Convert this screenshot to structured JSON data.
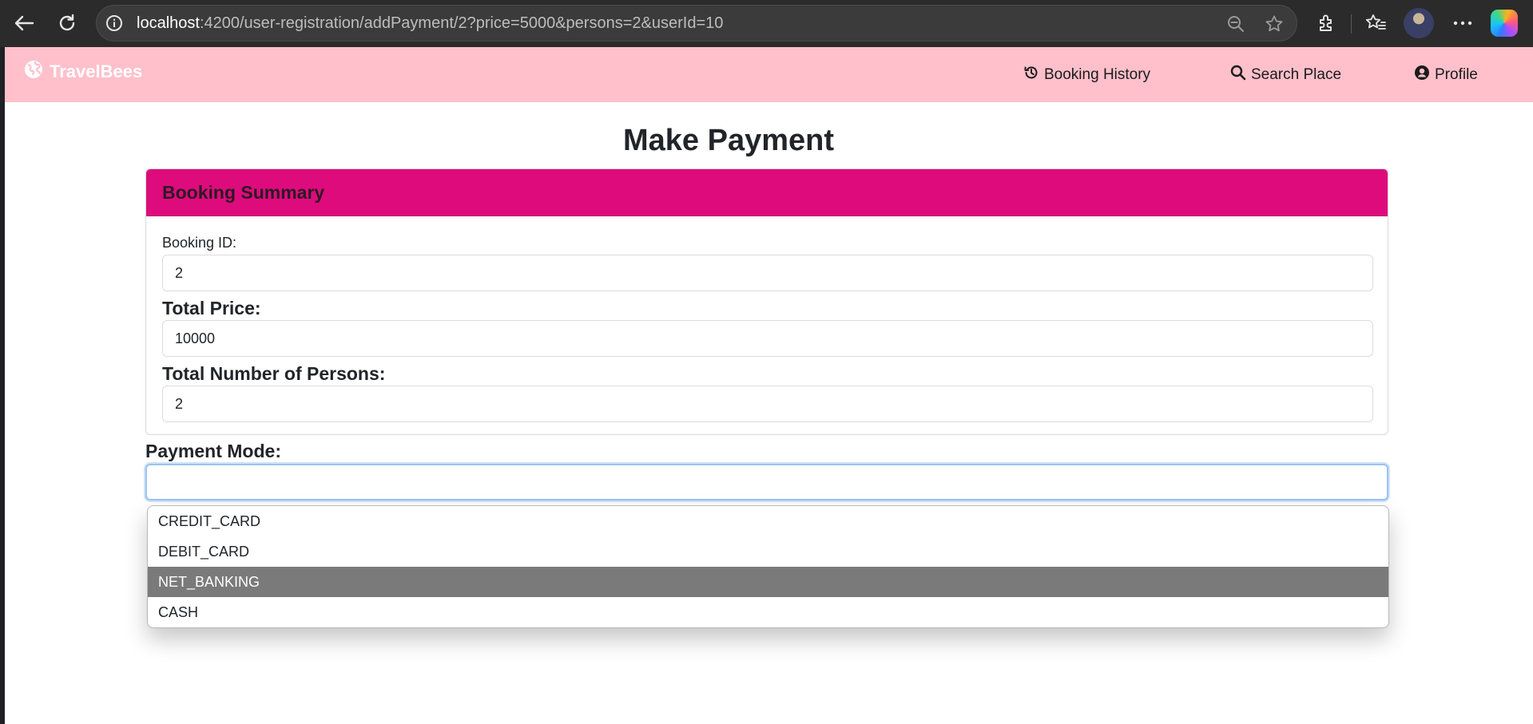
{
  "browser": {
    "url_host": "localhost",
    "url_path": ":4200/user-registration/addPayment/2?price=5000&persons=2&userId=10"
  },
  "navbar": {
    "brand": "TravelBees",
    "links": [
      {
        "label": "Booking History",
        "icon": "history-icon"
      },
      {
        "label": "Search Place",
        "icon": "search-icon"
      },
      {
        "label": "Profile",
        "icon": "user-circle-icon"
      }
    ],
    "background": "#ffc0cb"
  },
  "page": {
    "title": "Make Payment"
  },
  "summary": {
    "header": "Booking Summary",
    "header_color": "#de0b7c",
    "booking_id_label": "Booking ID:",
    "booking_id_value": "2",
    "total_price_label": "Total Price:",
    "total_price_value": "10000",
    "persons_label": "Total Number of Persons:",
    "persons_value": "2"
  },
  "payment": {
    "label": "Payment Mode:",
    "selected_value": "",
    "options": [
      "CREDIT_CARD",
      "DEBIT_CARD",
      "NET_BANKING",
      "CASH"
    ],
    "highlighted_option": "NET_BANKING"
  }
}
